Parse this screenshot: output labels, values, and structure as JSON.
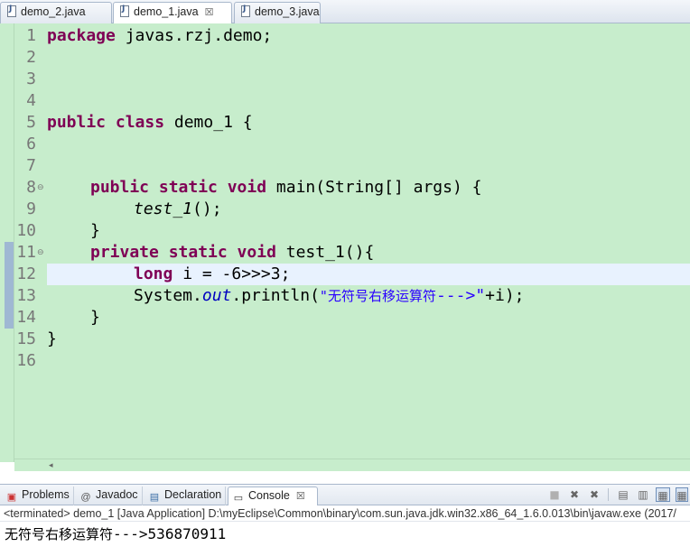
{
  "editor_tabs": [
    {
      "label": "demo_2.java",
      "active": false
    },
    {
      "label": "demo_1.java",
      "active": true,
      "close": "☒"
    },
    {
      "label": "demo_3.java",
      "active": false
    }
  ],
  "code": {
    "line_numbers": [
      "1",
      "2",
      "3",
      "4",
      "5",
      "6",
      "7",
      "8",
      "9",
      "10",
      "11",
      "12",
      "13",
      "14",
      "15",
      "16"
    ],
    "current_line": 12,
    "lines": {
      "l1_kw": "package",
      "l1_rest": " javas.rzj.demo;",
      "l5_kw": "public class",
      "l5_rest": " demo_1 {",
      "l8_kw": "public static void",
      "l8_rest": " main(String[] args) {",
      "l9_call": "test_1",
      "l9_rest": "();",
      "l10": "}",
      "l11_kw": "private static void",
      "l11_rest": " test_1(){",
      "l12_kw": "long",
      "l12_rest": " i = -6>>>3;",
      "l13_a": "System.",
      "l13_field": "out",
      "l13_b": ".println(",
      "l13_str_cjk": "\"无符号右移运算符",
      "l13_str_ascii": "--->\"",
      "l13_c": "+i);",
      "l14": "}",
      "l15": "}"
    }
  },
  "console_view": {
    "tabs": [
      {
        "label": "Problems",
        "icon": "problems-icon"
      },
      {
        "label": "Javadoc",
        "icon": "at-icon"
      },
      {
        "label": "Declaration",
        "icon": "declaration-icon"
      },
      {
        "label": "Console",
        "icon": "console-icon",
        "active": true,
        "close": "☒"
      }
    ],
    "status": "<terminated> demo_1 [Java Application] D:\\myEclipse\\Common\\binary\\com.sun.java.jdk.win32.x86_64_1.6.0.013\\bin\\javaw.exe (2017/",
    "output_cjk": "无符号右移运算符",
    "output_rest": "--->536870911"
  },
  "colors": {
    "editor_background": "#c7edcc",
    "keyword": "#7f0055",
    "string": "#2a00ff",
    "field": "#0000c0",
    "current_line": "#e8f2fe"
  }
}
